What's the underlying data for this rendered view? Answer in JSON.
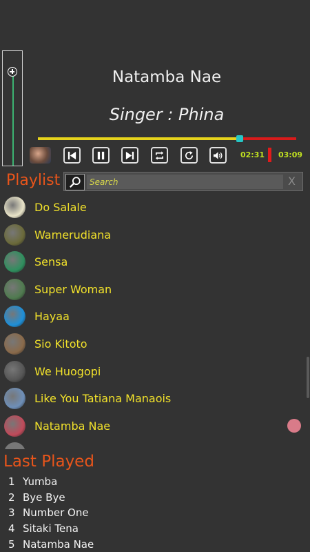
{
  "player": {
    "song_title": "Natamba Nae",
    "singer": "Singer : Phina",
    "progress_fraction": 0.78,
    "time_current": "02:31",
    "time_total": "03:09",
    "volume_level": 1.0
  },
  "controls": [
    "previous-icon",
    "pause-icon",
    "next-icon",
    "repeat-icon",
    "refresh-icon",
    "volume-icon"
  ],
  "playlist": {
    "label": "Playlist",
    "search_placeholder": "Search",
    "search_clear": "X",
    "items": [
      {
        "name": "Do Salale",
        "thumb": "#e9e4c8"
      },
      {
        "name": "Wamerudiana",
        "thumb": "#6b6a3a"
      },
      {
        "name": "Sensa",
        "thumb": "#2f8f5e"
      },
      {
        "name": "Super Woman",
        "thumb": "#4f7a4f"
      },
      {
        "name": "Hayaa",
        "thumb": "#1e8fd8"
      },
      {
        "name": "Sio Kitoto",
        "thumb": "#8a6a4a"
      },
      {
        "name": "We Huogopi",
        "thumb": "#555555"
      },
      {
        "name": "Like You Tatiana Manaois",
        "thumb": "#6e8fb8"
      },
      {
        "name": "Natamba Nae",
        "thumb": "#c04a5a",
        "current": true
      }
    ]
  },
  "last_played": {
    "label": "Last Played",
    "items": [
      {
        "num": "1",
        "name": "Yumba"
      },
      {
        "num": "2",
        "name": "Bye Bye"
      },
      {
        "num": "3",
        "name": "Number One"
      },
      {
        "num": "4",
        "name": "Sitaki Tena"
      },
      {
        "num": "5",
        "name": "Natamba Nae"
      }
    ]
  },
  "colors": {
    "accent_orange": "#e8551b",
    "song_yellow": "#f2e22b",
    "time_green": "#c0e020",
    "progress_red": "#d81b1b",
    "progress_yellow": "#e6d31c",
    "current_dot": "#d97b89"
  }
}
